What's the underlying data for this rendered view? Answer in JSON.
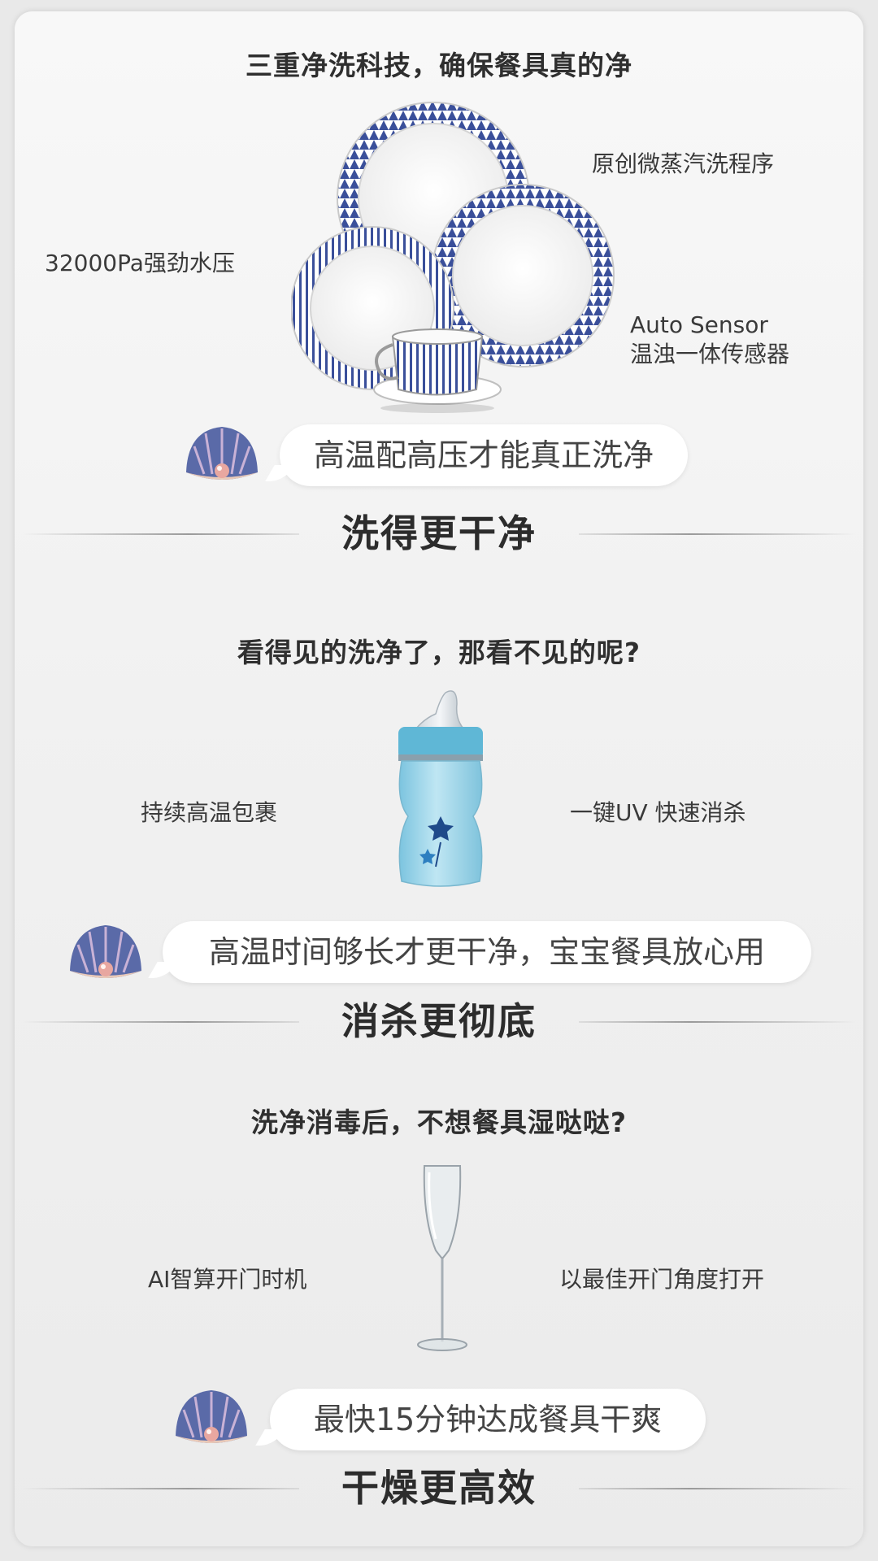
{
  "section1": {
    "headline": "三重净洗科技，确保餐具真的净",
    "feature_top_right": "原创微蒸汽洗程序",
    "feature_left": "32000Pa强劲水压",
    "feature_bottom_right_line1": "Auto Sensor",
    "feature_bottom_right_line2": "温浊一体传感器",
    "bubble": "高温配高压才能真正洗净",
    "title": "洗得更干净"
  },
  "section2": {
    "headline": "看得见的洗净了，那看不见的呢?",
    "feature_left": "持续高温包裹",
    "feature_right": "一键UV 快速消杀",
    "bubble": "高温时间够长才更干净，宝宝餐具放心用",
    "title": "消杀更彻底"
  },
  "section3": {
    "headline": "洗净消毒后，不想餐具湿哒哒?",
    "feature_left": "AI智算开门时机",
    "feature_right": "以最佳开门角度打开",
    "bubble": "最快15分钟达成餐具干爽",
    "title": "干燥更高效"
  },
  "icons": {
    "shell": "shell-pearl-icon",
    "plates": "dinnerware-plates-image",
    "bottle": "baby-bottle-image",
    "glass": "champagne-glass-image"
  },
  "colors": {
    "plate_pattern": "#3a4f9a",
    "bottle_body": "#9fd6ea",
    "shell": "#5a6aa8",
    "pearl": "#e8a7a0"
  }
}
